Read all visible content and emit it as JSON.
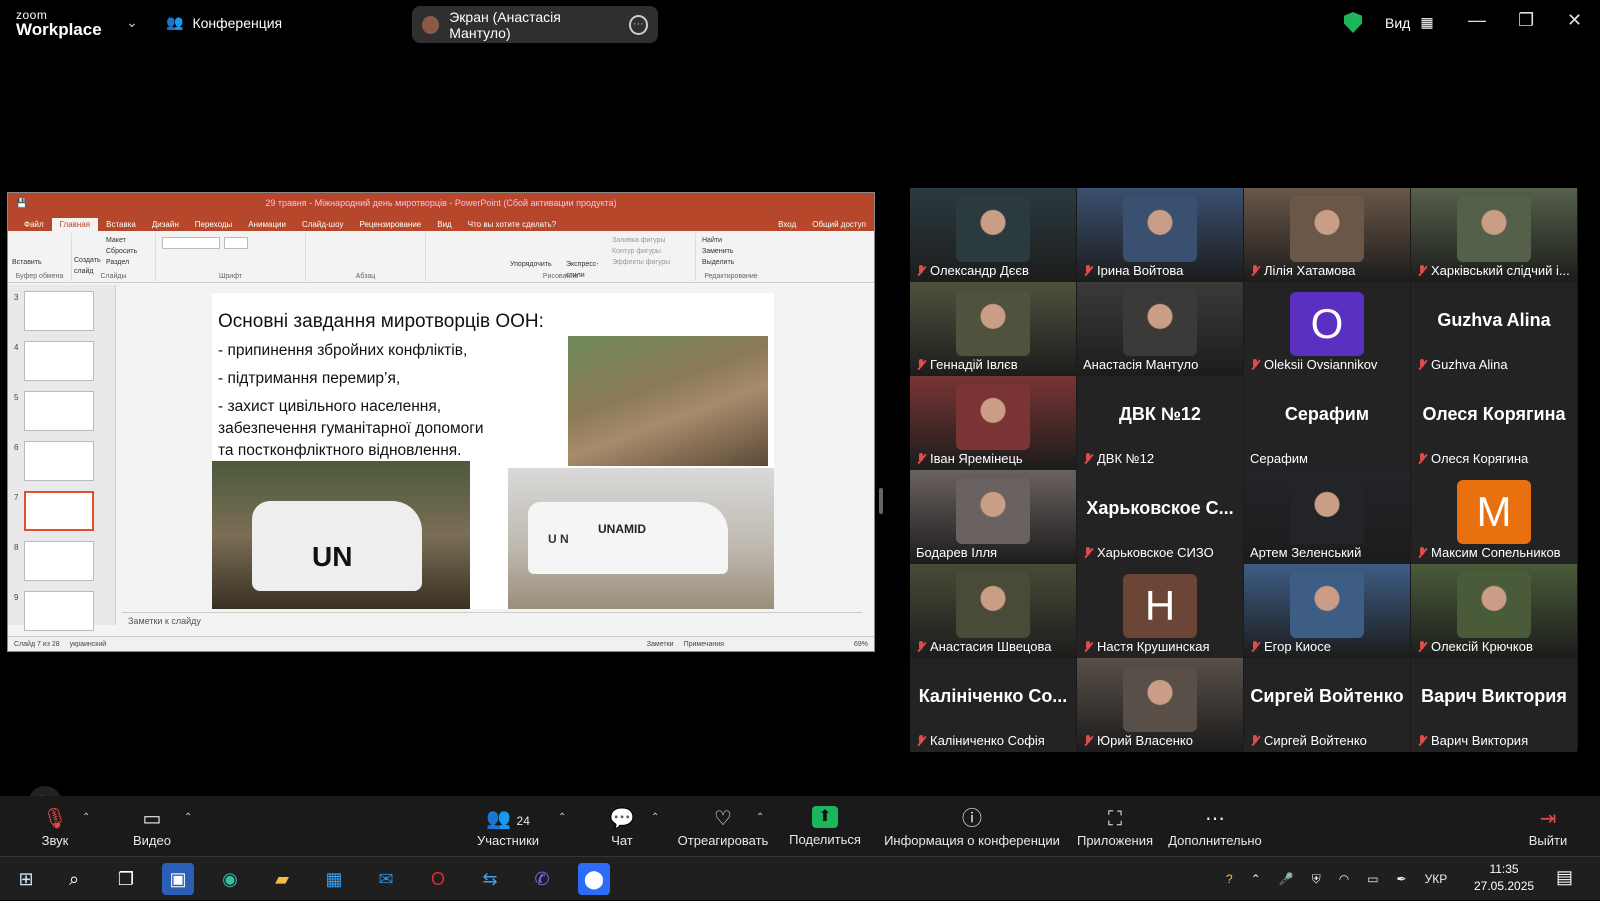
{
  "app": {
    "logo_top": "zoom",
    "logo_bottom": "Workplace",
    "meeting_label": "Конференция",
    "screen_pill": "Экран (Анастасія Мантуло)",
    "view_label": "Вид"
  },
  "ppt": {
    "title": "29 травня - Міжнародний день миротворців - PowerPoint (Сбой активации продукта)",
    "tabs": [
      "Файл",
      "Главная",
      "Вставка",
      "Дизайн",
      "Переходы",
      "Анимации",
      "Слайд-шоу",
      "Рецензирование",
      "Вид",
      "Что вы хотите сделать?"
    ],
    "tabs_right": [
      "Вход",
      "Общий доступ"
    ],
    "ribbon": {
      "clipboard": "Буфер обмена",
      "paste": "Вставить",
      "slides": "Слайды",
      "create_slide": "Создать слайд",
      "layout": "Макет",
      "reset": "Сбросить",
      "section": "Раздел",
      "font": "Шрифт",
      "paragraph": "Абзац",
      "drawing": "Рисование",
      "arrange": "Упорядочить",
      "quick_styles": "Экспресс-стили",
      "fill": "Заливка фигуры",
      "outline": "Контур фигуры",
      "effects": "Эффекты фигуры",
      "editing": "Редактирование",
      "find": "Найти",
      "replace": "Заменить",
      "select": "Выделить"
    },
    "thumb_numbers": [
      "3",
      "4",
      "5",
      "6",
      "7",
      "8",
      "9"
    ],
    "slide": {
      "heading": "Основні завдання миротворців ООН:",
      "bullets": [
        "- припинення збройних конфліктів,",
        "- підтримання перемир’я,",
        "- захист цивільного населення,",
        "забезпечення гуманітарної допомоги",
        "та постконфліктного відновлення."
      ],
      "vehicle1": "UN",
      "vehicle2": "UNAMID",
      "vehicle2_side": "U N"
    },
    "notes": "Заметки к слайду",
    "status": {
      "slide": "Слайд 7 из 28",
      "lang": "украинский",
      "notes": "Заметки",
      "comments": "Примечания",
      "zoom": "69%"
    }
  },
  "participants": [
    {
      "name": "Олександр Дєєв",
      "muted": true,
      "type": "video",
      "color": "#2b3a3f"
    },
    {
      "name": "Ірина Войтова",
      "muted": true,
      "type": "video",
      "color": "#3a5070"
    },
    {
      "name": "Лілія Хатамова",
      "muted": true,
      "type": "video",
      "color": "#6a5748"
    },
    {
      "name": "Харківський слідчий і...",
      "muted": true,
      "type": "video",
      "color": "#55604a"
    },
    {
      "name": "Геннадій Івлєв",
      "muted": true,
      "type": "video",
      "color": "#50523e"
    },
    {
      "name": "Анастасія Мантуло",
      "muted": false,
      "type": "video",
      "color": "#3c3a38",
      "active": true
    },
    {
      "name": "Oleksii Ovsiannikov",
      "muted": true,
      "type": "avatar",
      "letter": "O",
      "color": "#5b2fc0"
    },
    {
      "name": "Guzhva Alina",
      "muted": true,
      "type": "text",
      "big": "Guzhva Alina"
    },
    {
      "name": "Іван Яремінець",
      "muted": true,
      "type": "video",
      "color": "#7a3434"
    },
    {
      "name": "ДВК №12",
      "muted": true,
      "type": "text",
      "big": "ДВК №12"
    },
    {
      "name": "Серафим",
      "muted": false,
      "type": "text",
      "big": "Серафим"
    },
    {
      "name": "Олеся Корягина",
      "muted": true,
      "type": "text",
      "big": "Олеся Корягина"
    },
    {
      "name": "Бодарев Ілля",
      "muted": false,
      "type": "video",
      "color": "#6a6260"
    },
    {
      "name": "Харьковское СИЗО",
      "muted": true,
      "type": "text",
      "big": "Харьковское С..."
    },
    {
      "name": "Артем Зеленський",
      "muted": false,
      "type": "video",
      "color": "#222428"
    },
    {
      "name": "Максим Сопельников",
      "muted": true,
      "type": "avatar",
      "letter": "M",
      "color": "#e9700f"
    },
    {
      "name": "Анастасия Швецова",
      "muted": true,
      "type": "video",
      "color": "#4a4a38"
    },
    {
      "name": "Настя Крушинская",
      "muted": true,
      "type": "avatar",
      "letter": "H",
      "color": "#6b4536"
    },
    {
      "name": "Егор Киосе",
      "muted": true,
      "type": "video",
      "color": "#3e5d85"
    },
    {
      "name": "Олексій Крючков",
      "muted": true,
      "type": "video",
      "color": "#4a5b3a"
    },
    {
      "name": "Каліниченко Софія",
      "muted": true,
      "type": "text",
      "big": "Калініченко Со..."
    },
    {
      "name": "Юрий Власенко",
      "muted": true,
      "type": "video",
      "color": "#585048"
    },
    {
      "name": "Сиргей Войтенко",
      "muted": true,
      "type": "text",
      "big": "Сиргей Войтенко"
    },
    {
      "name": "Варич Виктория",
      "muted": true,
      "type": "text",
      "big": "Варич Виктория"
    }
  ],
  "toolbar": {
    "audio": "Звук",
    "video": "Видео",
    "participants": "Участники",
    "participants_count": "24",
    "chat": "Чат",
    "react": "Отреагировать",
    "share": "Поделиться",
    "info": "Информация о конференции",
    "apps": "Приложения",
    "more": "Дополнительно",
    "leave": "Выйти"
  },
  "taskbar": {
    "lang": "УКР",
    "time": "11:35",
    "date": "27.05.2025"
  }
}
